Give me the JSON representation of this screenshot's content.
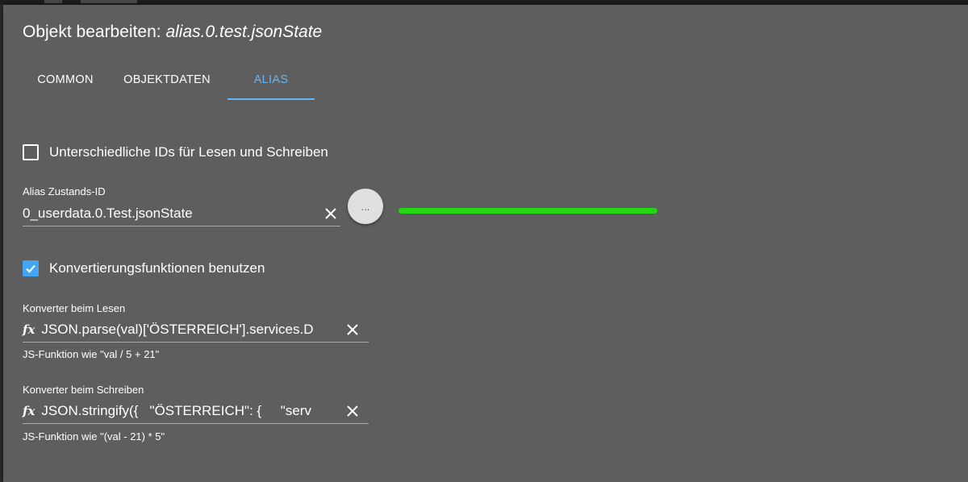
{
  "dialog": {
    "title_prefix": "Objekt bearbeiten: ",
    "object_id": "alias.0.test.jsonState",
    "tabs": [
      {
        "label": "COMMON"
      },
      {
        "label": "OBJEKTDATEN"
      },
      {
        "label": "ALIAS"
      }
    ],
    "active_tab": "ALIAS"
  },
  "alias": {
    "different_ids": {
      "label": "Unterschiedliche IDs für Lesen und Schreiben",
      "checked": false
    },
    "state_id": {
      "label": "Alias Zustands-ID",
      "value": "0_userdata.0.Test.jsonState",
      "select_button_label": "..."
    },
    "status_color": "#23d613",
    "use_conversion": {
      "label": "Konvertierungsfunktionen benutzen",
      "checked": true
    },
    "read_converter": {
      "label": "Konverter beim Lesen",
      "value": "JSON.parse(val)['ÖSTERREICH'].services.D",
      "helper": "JS-Funktion wie \"val / 5 + 21\""
    },
    "write_converter": {
      "label": "Konverter beim Schreiben",
      "value": "JSON.stringify({   \"ÖSTERREICH\": {     \"serv",
      "helper": "JS-Funktion wie \"(val - 21) * 5\""
    }
  },
  "icons": {
    "fx": "fx-function-icon",
    "clear": "close-icon",
    "check": "check-icon"
  },
  "colors": {
    "accent": "#64b5f6",
    "checkbox": "#42a5f5",
    "dialog_bg": "#5e5e5e"
  }
}
